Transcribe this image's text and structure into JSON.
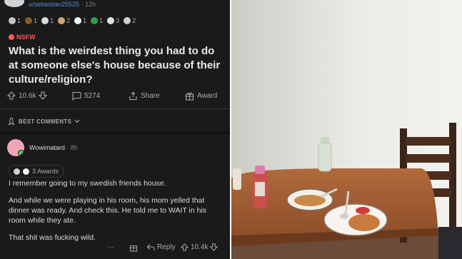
{
  "post": {
    "username": "u/sebastian25525",
    "age": "· 12h",
    "awards": [
      {
        "icon": "silver-award-icon",
        "count": "1",
        "color": "#c0c6c9"
      },
      {
        "icon": "poop-award-icon",
        "count": "1",
        "color": "#8b5a2b"
      },
      {
        "icon": "cup-award-icon",
        "count": "1",
        "color": "#d9d9d9"
      },
      {
        "icon": "helpful-award-icon",
        "count": "2",
        "color": "#d4a373"
      },
      {
        "icon": "wholesome-award-icon",
        "count": "1",
        "color": "#f3f3f3"
      },
      {
        "icon": "question-award-icon",
        "count": "1",
        "color": "#2fa14a"
      },
      {
        "icon": "coin-award-icon",
        "count": "3",
        "color": "#e0e0e0"
      },
      {
        "icon": "crowd-award-icon",
        "count": "2",
        "color": "#cfcfcf"
      }
    ],
    "nsfw_label": "NSFW",
    "title": "What is the weirdest thing you had to do at someone else's house because of their culture/religion?",
    "votes": "10.6k",
    "comments": "5274",
    "share_label": "Share",
    "award_label": "Award"
  },
  "sort": {
    "label": "BEST COMMENTS"
  },
  "comment": {
    "username": "Wowimatard",
    "age": "· 8h",
    "awards_label": "3 Awards",
    "paragraphs": [
      "I remember going to my swedish friends house.",
      "And while we were playing in his room, his mom yelled that dinner was ready. And check this. He told me to WAIT in his room while they ate.",
      "That shit was fucking wild."
    ],
    "more_label": "···",
    "reply_label": "Reply",
    "votes": "10.4k"
  },
  "colors": {
    "background": "#1a1a1b",
    "text": "#d7dadc",
    "muted": "#a8aaab",
    "username_blue": "#4f8fd6",
    "nsfw": "#ff585b",
    "online": "#46d160"
  }
}
